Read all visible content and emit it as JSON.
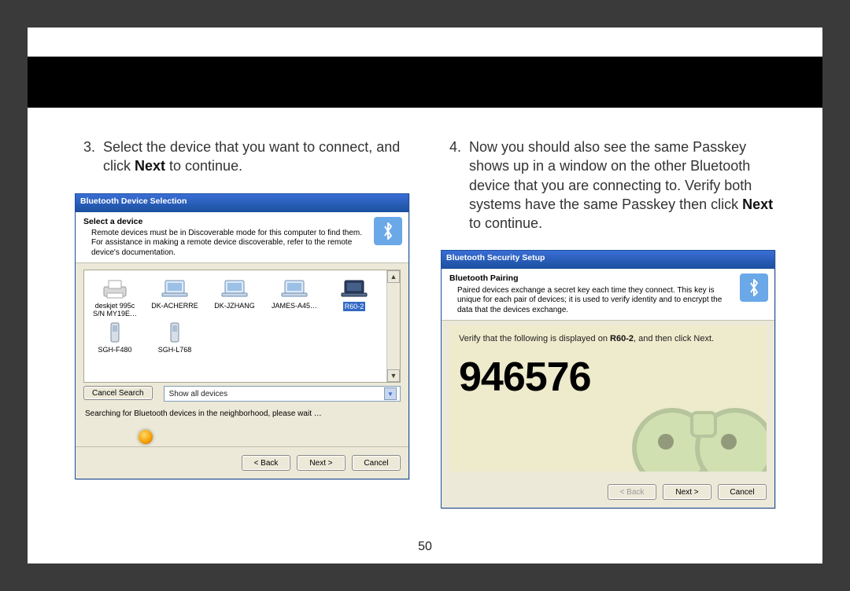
{
  "page_number": "50",
  "step3": {
    "num": "3.",
    "text_a": "Select the device that you want to connect, and click ",
    "bold": "Next",
    "text_b": " to continue."
  },
  "step4": {
    "num": "4.",
    "text_a": "Now you should also see the same Passkey shows up in a window on the other Bluetooth device that you are connecting to.  Verify both systems have the same Passkey then click ",
    "bold": "Next",
    "text_b": " to continue."
  },
  "dialog1": {
    "title": "Bluetooth Device Selection",
    "info_header": "Select a device",
    "info_line1": "Remote devices must be in Discoverable mode for this computer to find them.",
    "info_line2": "For assistance in making a remote device discoverable, refer to the remote device's documentation.",
    "devices": [
      {
        "label": "deskjet 995c S/N MY19E…",
        "kind": "printer"
      },
      {
        "label": "DK-ACHERRE",
        "kind": "laptop"
      },
      {
        "label": "DK-JZHANG",
        "kind": "laptop"
      },
      {
        "label": "JAMES-A45…",
        "kind": "laptop"
      },
      {
        "label": "R60-2",
        "kind": "laptop",
        "selected": true
      },
      {
        "label": "SGH-F480",
        "kind": "phone"
      },
      {
        "label": "SGH-L768",
        "kind": "phone"
      }
    ],
    "cancel_search": "Cancel Search",
    "filter": "Show all devices",
    "status": "Searching for Bluetooth devices in the neighborhood, please wait …",
    "back": "< Back",
    "next": "Next >",
    "cancel": "Cancel"
  },
  "dialog2": {
    "title": "Bluetooth Security Setup",
    "info_header": "Bluetooth Pairing",
    "info_body": "Paired devices exchange a secret key each time they connect. This key is unique for each pair of devices; it is used to verify identity and to encrypt the data that the devices exchange.",
    "verify_a": "Verify that the following is displayed on ",
    "verify_bold": "R60-2",
    "verify_b": ", and then click Next.",
    "passkey": "946576",
    "back": "< Back",
    "next": "Next >",
    "cancel": "Cancel"
  }
}
